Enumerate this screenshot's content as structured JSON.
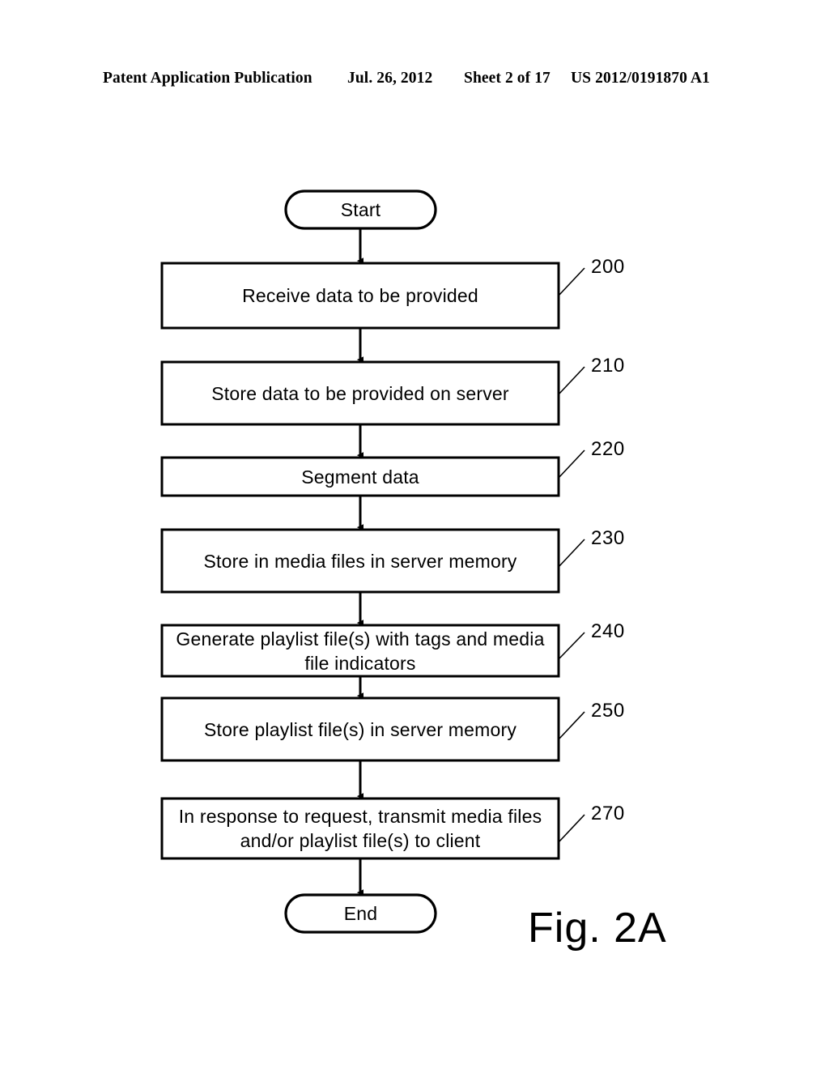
{
  "header": {
    "publication": "Patent Application Publication",
    "date": "Jul. 26, 2012",
    "sheet": "Sheet 2 of 17",
    "patent_number": "US 2012/0191870 A1"
  },
  "figure": {
    "caption": "Fig. 2A",
    "start_label": "Start",
    "end_label": "End",
    "steps": [
      {
        "ref": "200",
        "text": "Receive data to be provided"
      },
      {
        "ref": "210",
        "text": "Store data to be provided on server"
      },
      {
        "ref": "220",
        "text": "Segment data"
      },
      {
        "ref": "230",
        "text": "Store in media files in server memory"
      },
      {
        "ref": "240",
        "text": "Generate playlist file(s) with tags and media file indicators"
      },
      {
        "ref": "250",
        "text": "Store playlist file(s) in server memory"
      },
      {
        "ref": "270",
        "text": "In response to request, transmit media files and/or playlist file(s) to client"
      }
    ]
  },
  "colors": {
    "ink": "#000000",
    "background": "#ffffff"
  }
}
